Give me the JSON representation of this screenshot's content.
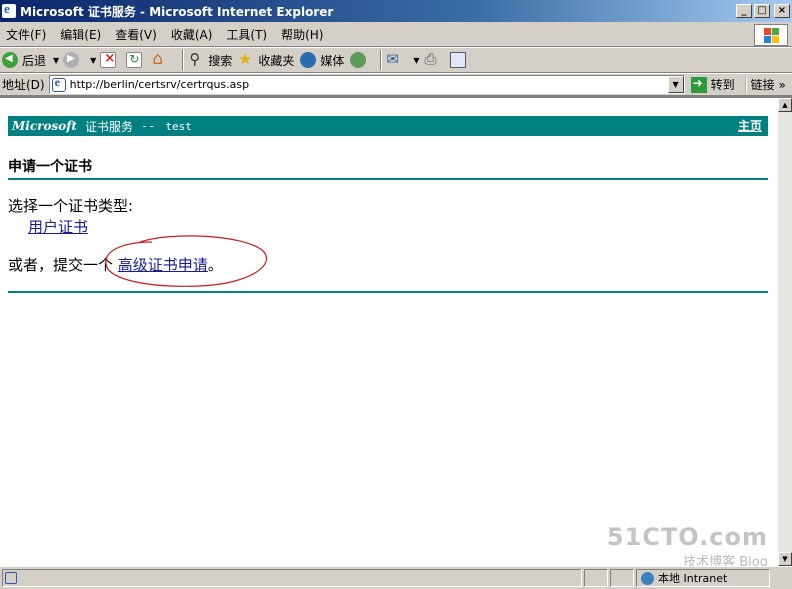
{
  "window": {
    "title": "Microsoft 证书服务 - Microsoft Internet Explorer",
    "controls": [
      "_",
      "□",
      "×"
    ]
  },
  "menu": [
    {
      "label": "文件(F)"
    },
    {
      "label": "编辑(E)"
    },
    {
      "label": "查看(V)"
    },
    {
      "label": "收藏(A)"
    },
    {
      "label": "工具(T)"
    },
    {
      "label": "帮助(H)"
    }
  ],
  "toolbar": {
    "back_label": "后退",
    "search_label": "搜索",
    "favorites_label": "收藏夹",
    "media_label": "媒体"
  },
  "address": {
    "label": "地址(D)",
    "url": "http://berlin/certsrv/certrqus.asp",
    "go_label": "转到",
    "links_label": "链接",
    "links_chevron": "»"
  },
  "page": {
    "banner_brand": "Microsoft",
    "banner_service": "证书服务",
    "banner_separator": "--",
    "banner_ca": "test",
    "home_link": "主页",
    "heading": "申请一个证书",
    "prompt": "选择一个证书类型:",
    "user_cert_link": "用户证书",
    "or_prefix": "或者，提交一个",
    "advanced_link": "高级证书申请",
    "or_suffix": "。"
  },
  "watermark": {
    "line1": "51CTO.com",
    "line2": "技术博客 Blog"
  },
  "status": {
    "zone": "本地 Intranet"
  },
  "colors": {
    "banner": "#008080",
    "link": "#1a1a9a",
    "annotation": "#c81e1e"
  }
}
